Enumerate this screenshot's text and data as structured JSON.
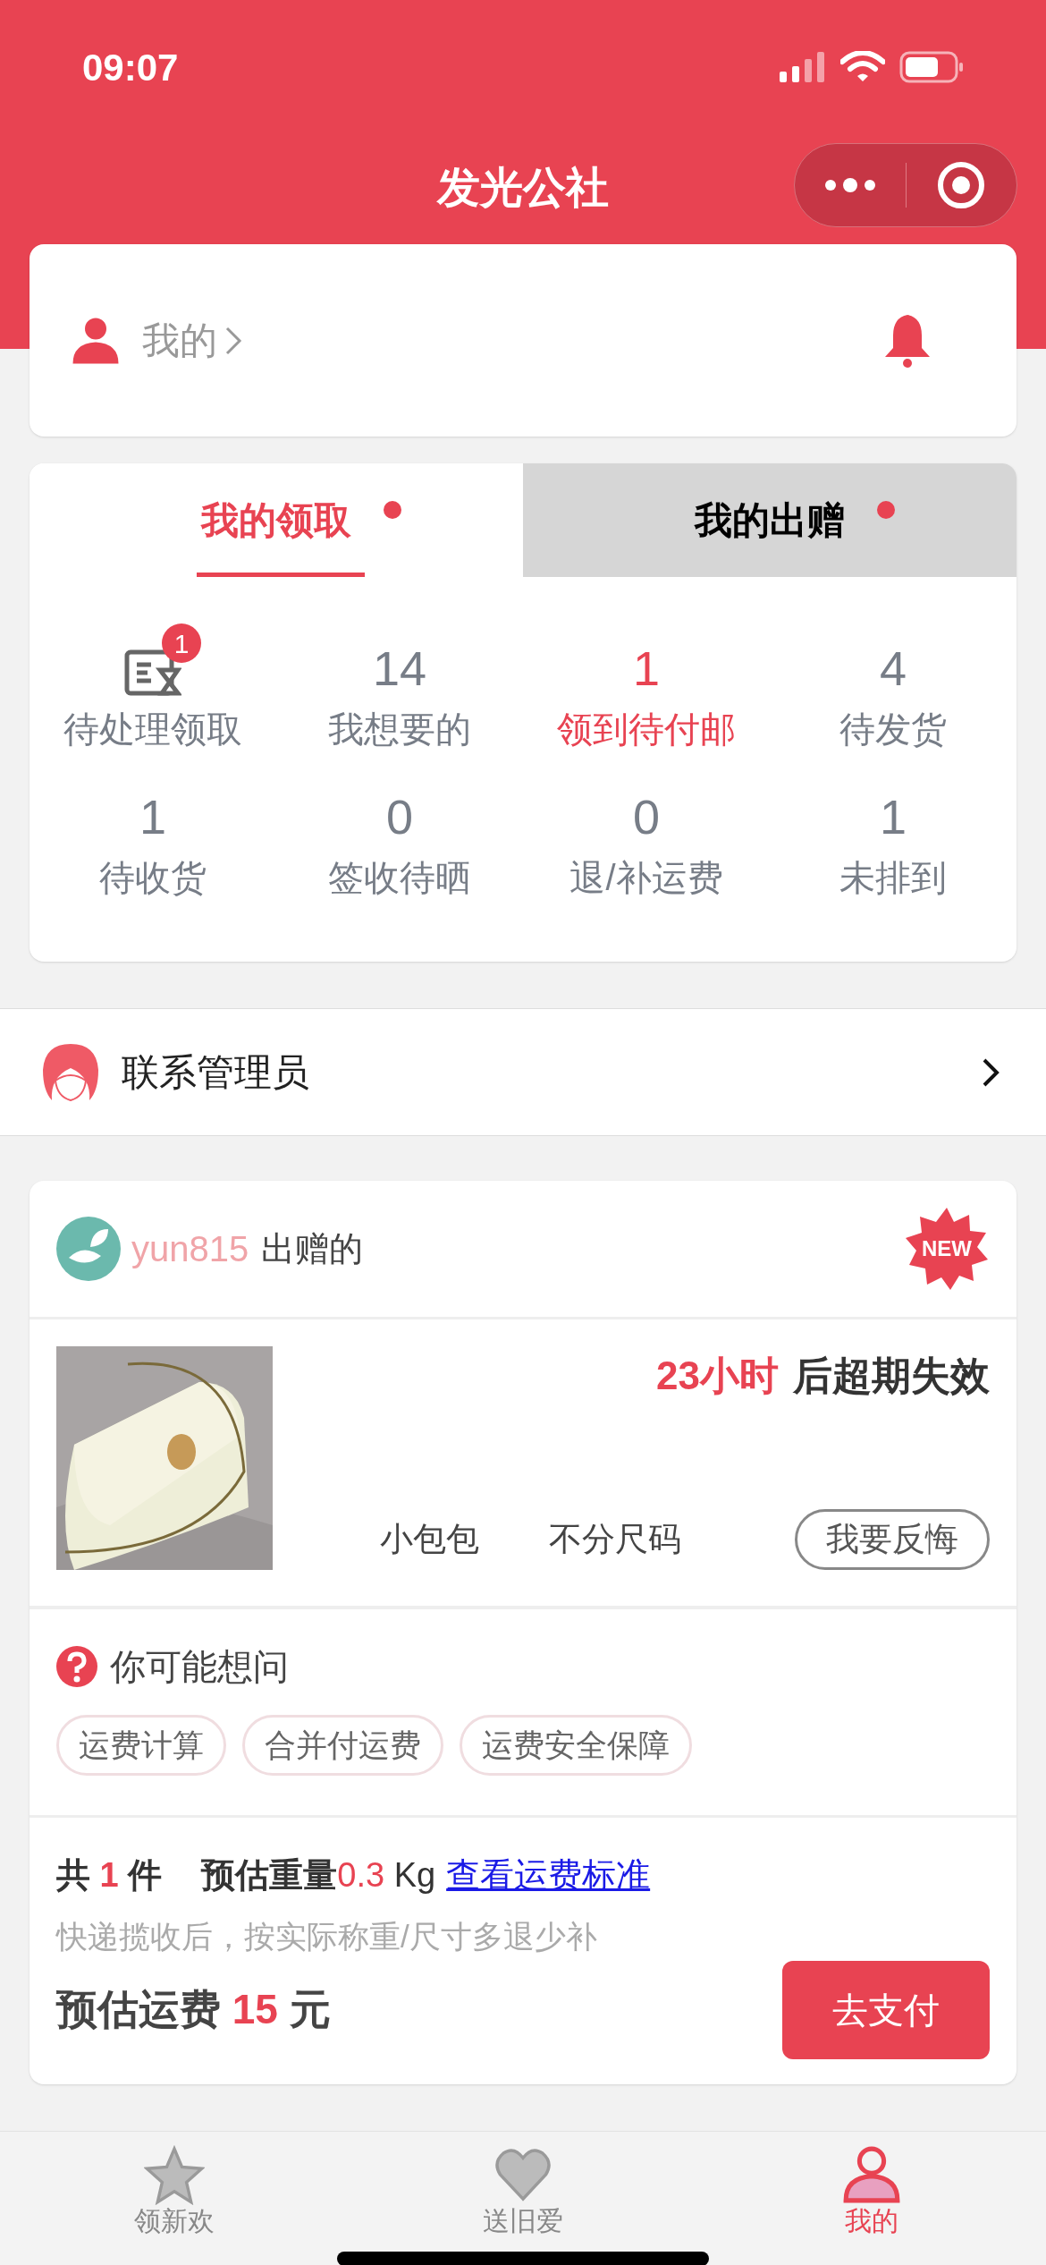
{
  "status_bar": {
    "time": "09:07"
  },
  "nav": {
    "title": "发光公社"
  },
  "profile": {
    "label": "我的"
  },
  "tabs": [
    {
      "label": "我的领取",
      "selected": true,
      "dot": true
    },
    {
      "label": "我的出赠",
      "selected": false,
      "dot": true
    }
  ],
  "stats": [
    {
      "kind": "icon",
      "badge": "1",
      "label": "待处理领取",
      "highlight": false
    },
    {
      "kind": "number",
      "value": "14",
      "label": "我想要的",
      "highlight": false
    },
    {
      "kind": "number",
      "value": "1",
      "label": "领到待付邮",
      "highlight": true
    },
    {
      "kind": "number",
      "value": "4",
      "label": "待发货",
      "highlight": false
    },
    {
      "kind": "number",
      "value": "1",
      "label": "待收货",
      "highlight": false
    },
    {
      "kind": "number",
      "value": "0",
      "label": "签收待晒",
      "highlight": false
    },
    {
      "kind": "number",
      "value": "0",
      "label": "退/补运费",
      "highlight": false
    },
    {
      "kind": "number",
      "value": "1",
      "label": "未排到",
      "highlight": false
    }
  ],
  "contact": {
    "label": "联系管理员"
  },
  "gift": {
    "user": "yun815",
    "action": "出赠的",
    "badge": "NEW",
    "countdown": "23小时",
    "expiry": "后超期失效",
    "item_name": "小包包",
    "size": "不分尺码",
    "regret_button": "我要反悔",
    "faq_title": "你可能想问",
    "faq_tags": [
      "运费计算",
      "合并付运费",
      "运费安全保障"
    ],
    "count_prefix": "共",
    "count": "1",
    "count_suffix": "件",
    "weight_label": "预估重量",
    "weight": "0.3",
    "weight_unit": "Kg",
    "link": "查看运费标准",
    "note": "快递揽收后，按实际称重/尺寸多退少补",
    "fee_label": "预估运费",
    "fee": "15",
    "fee_unit": "元",
    "pay_button": "去支付"
  },
  "tab_bar": [
    {
      "label": "领新欢",
      "selected": false
    },
    {
      "label": "送旧爱",
      "selected": false
    },
    {
      "label": "我的",
      "selected": true
    }
  ]
}
